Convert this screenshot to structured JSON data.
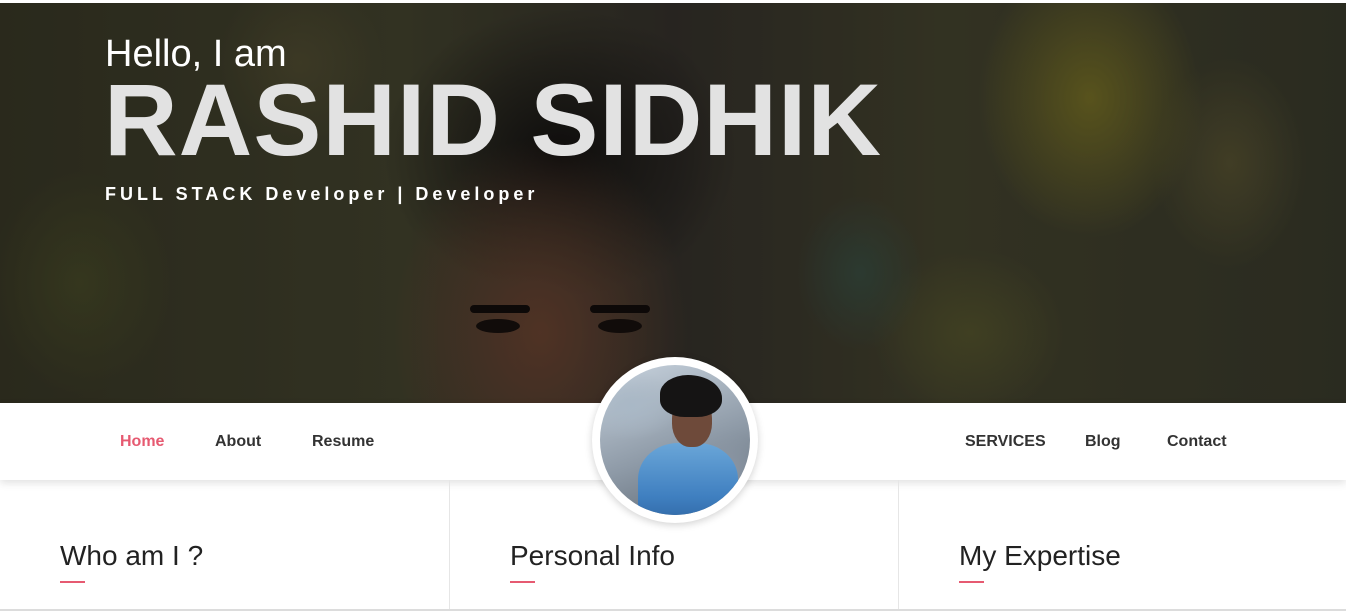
{
  "hero": {
    "greeting": "Hello, I am",
    "name": "RASHID SIDHIK",
    "tagline": "FULL STACK Developer | Developer"
  },
  "nav": {
    "left": [
      "Home",
      "About",
      "Resume"
    ],
    "right": [
      "SERVICES",
      "Blog",
      "Contact"
    ],
    "active": "Home"
  },
  "sections": {
    "who_am_i": "Who am I ?",
    "personal_info": "Personal Info",
    "my_expertise": "My Expertise"
  },
  "colors": {
    "accent": "#e65a71",
    "nav_text": "#333333",
    "heading_text": "#222222"
  }
}
